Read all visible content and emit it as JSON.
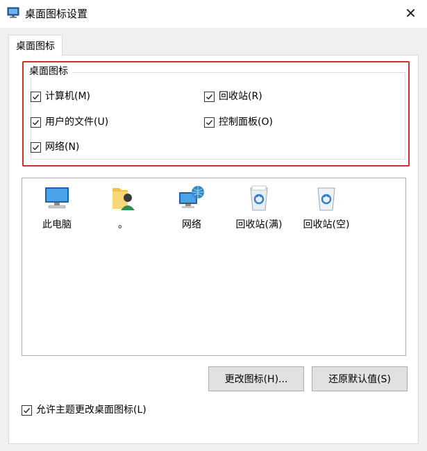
{
  "window": {
    "title": "桌面图标设置",
    "close_glyph": "✕"
  },
  "tabs": [
    {
      "label": "桌面图标"
    }
  ],
  "group": {
    "title": "桌面图标",
    "checkboxes": [
      {
        "label": "计算机(M)",
        "checked": true
      },
      {
        "label": "回收站(R)",
        "checked": true
      },
      {
        "label": "用户的文件(U)",
        "checked": true
      },
      {
        "label": "控制面板(O)",
        "checked": true
      },
      {
        "label": "网络(N)",
        "checked": true
      }
    ]
  },
  "icons": [
    {
      "label": "此电脑",
      "icon": "computer-icon"
    },
    {
      "label": "。",
      "icon": "user-folder-icon"
    },
    {
      "label": "网络",
      "icon": "network-icon"
    },
    {
      "label": "回收站(满)",
      "icon": "recycle-bin-full-icon"
    },
    {
      "label": "回收站(空)",
      "icon": "recycle-bin-empty-icon"
    }
  ],
  "buttons": {
    "change_icon": "更改图标(H)...",
    "restore_default": "还原默认值(S)"
  },
  "allow_themes": {
    "label": "允许主题更改桌面图标(L)",
    "checked": true
  },
  "colors": {
    "highlight": "#d32f2f",
    "client_bg": "#f0f0f0",
    "button_bg": "#e1e1e1"
  }
}
